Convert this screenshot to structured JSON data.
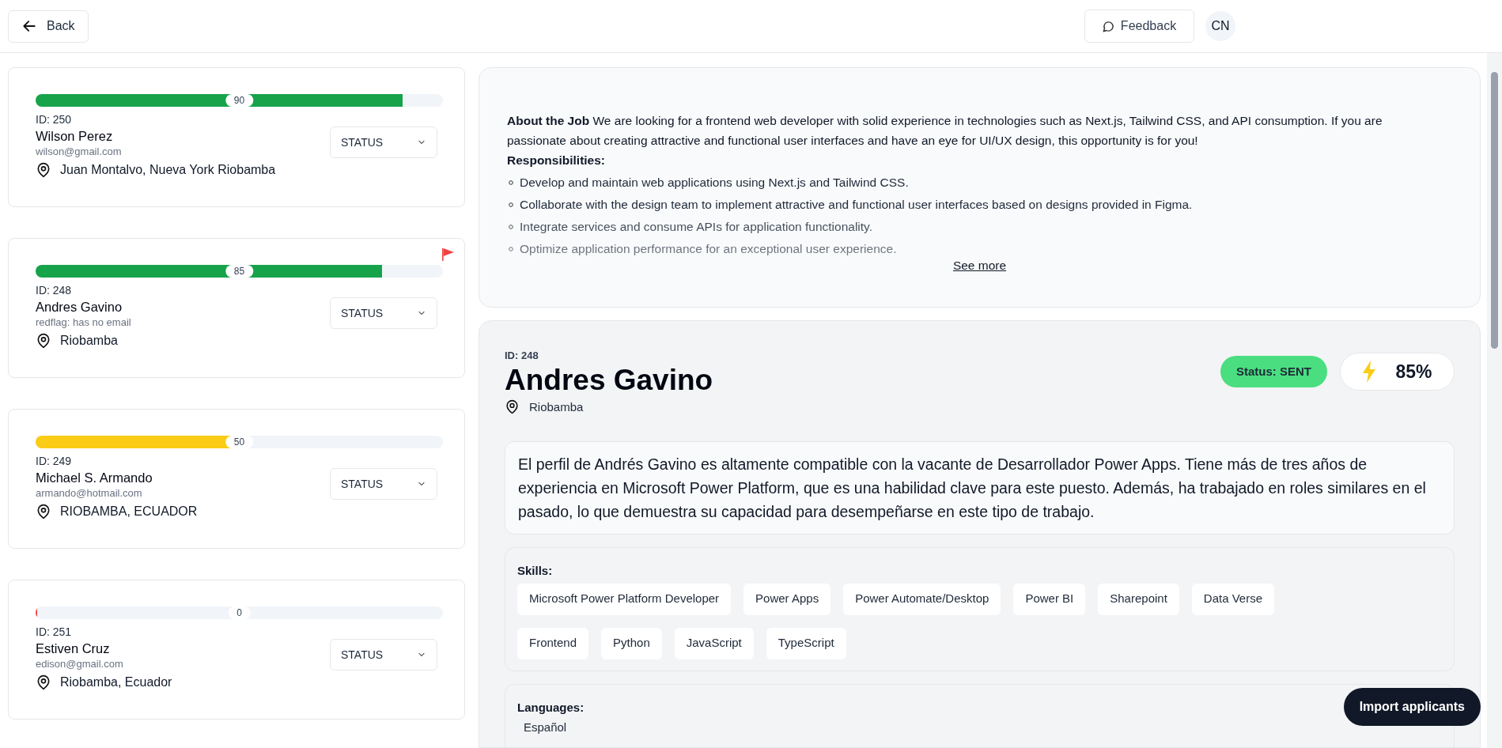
{
  "header": {
    "back": "Back",
    "feedback": "Feedback",
    "avatar": "CN"
  },
  "applicants": [
    {
      "score": "90",
      "level": 0.9,
      "id": "ID: 250",
      "name": "Wilson Perez",
      "email": "wilson@gmail.com",
      "location": "Juan Montalvo, Nueva York Riobamba",
      "status": "STATUS",
      "flagged": false
    },
    {
      "score": "85",
      "level": 0.85,
      "id": "ID: 248",
      "name": "Andres Gavino",
      "email": "redflag: has no email",
      "location": "Riobamba",
      "status": "STATUS",
      "flagged": true
    },
    {
      "score": "50",
      "level": 0.5,
      "id": "ID: 249",
      "name": "Michael S. Armando",
      "email": "armando@hotmail.com",
      "location": "RIOBAMBA, ECUADOR",
      "status": "STATUS",
      "flagged": false
    },
    {
      "score": "0",
      "level": 0,
      "id": "ID: 251",
      "name": "Estiven Cruz",
      "email": "edison@gmail.com",
      "location": "Riobamba, Ecuador",
      "status": "STATUS",
      "flagged": false
    }
  ],
  "job": {
    "intro": "**About the Job** We are looking for a frontend web developer with solid experience in technologies such as Next.js, Tailwind CSS, and API consumption. If you are passionate about creating attractive and functional user interfaces and have an eye for UI/UX design, this opportunity is for you!",
    "responsibilities_title": "Responsibilities:",
    "responsibilities": [
      "Develop and maintain web applications using Next.js and Tailwind CSS.",
      "Collaborate with the design team to implement attractive and functional user interfaces based on designs provided in Figma.",
      "Integrate services and consume APIs for application functionality.",
      "Optimize application performance for an exceptional user experience."
    ],
    "see_more": "See more"
  },
  "candidate": {
    "id": "ID: 248",
    "name": "Andres Gavino",
    "location": "Riobamba",
    "status": "Status: SENT",
    "score": "85%",
    "summary": "El perfil de Andrés Gavino es altamente compatible con la vacante de Desarrollador Power Apps. Tiene más de tres años de experiencia en Microsoft Power Platform, que es una habilidad clave para este puesto. Además, ha trabajado en roles similares en el pasado, lo que demuestra su capacidad para desempeñarse en este tipo de trabajo.",
    "skills_title": "Skills:",
    "skills": [
      "Microsoft Power Platform Developer",
      "Power Apps",
      "Power Automate/Desktop",
      "Power BI",
      "Sharepoint",
      "Data Verse",
      "Frontend",
      "Python",
      "JavaScript",
      "TypeScript"
    ],
    "languages_title": "Languages:",
    "languages": [
      "Español"
    ]
  },
  "import_button": "Import applicants"
}
